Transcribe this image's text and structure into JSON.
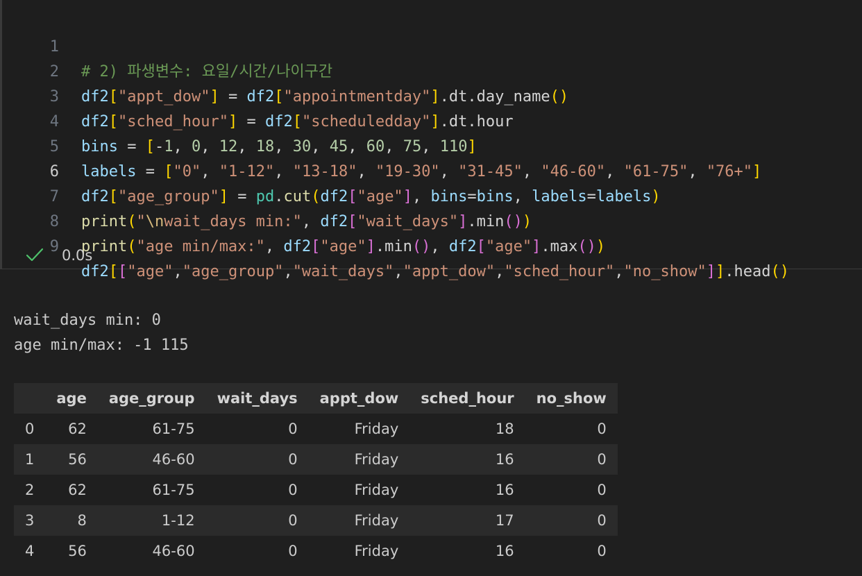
{
  "cell": {
    "line_numbers": [
      "1",
      "2",
      "3",
      "4",
      "5",
      "6",
      "7",
      "8",
      "9"
    ],
    "code_lines": [
      "# 2) 파생변수: 요일/시간/나이구간",
      "df2[\"appt_dow\"] = df2[\"appointmentday\"].dt.day_name()",
      "df2[\"sched_hour\"] = df2[\"scheduledday\"].dt.hour",
      "bins = [-1, 0, 12, 18, 30, 45, 60, 75, 110]",
      "labels = [\"0\", \"1-12\", \"13-18\", \"19-30\", \"31-45\", \"46-60\", \"61-75\", \"76+\"]",
      "df2[\"age_group\"] = pd.cut(df2[\"age\"], bins=bins, labels=labels)",
      "print(\"\\nwait_days min:\", df2[\"wait_days\"].min())",
      "print(\"age min/max:\", df2[\"age\"].min(), df2[\"age\"].max())",
      "df2[[\"age\",\"age_group\",\"wait_days\",\"appt_dow\",\"sched_hour\",\"no_show\"]].head()"
    ],
    "status": {
      "icon": "check-icon",
      "elapsed": "0.0s"
    }
  },
  "output": {
    "stdout": [
      "wait_days min: 0",
      "age min/max: -1 115"
    ],
    "table": {
      "columns": [
        "",
        "age",
        "age_group",
        "wait_days",
        "appt_dow",
        "sched_hour",
        "no_show"
      ],
      "rows": [
        [
          "0",
          "62",
          "61-75",
          "0",
          "Friday",
          "18",
          "0"
        ],
        [
          "1",
          "56",
          "46-60",
          "0",
          "Friday",
          "16",
          "0"
        ],
        [
          "2",
          "62",
          "61-75",
          "0",
          "Friday",
          "16",
          "0"
        ],
        [
          "3",
          "8",
          "1-12",
          "0",
          "Friday",
          "17",
          "0"
        ],
        [
          "4",
          "56",
          "46-60",
          "0",
          "Friday",
          "16",
          "0"
        ]
      ]
    }
  },
  "colors": {
    "background": "#1f1f1f",
    "cell_background": "#1e1e1e",
    "check": "#4ec26b",
    "table_stripe": "#2b2b2b"
  }
}
